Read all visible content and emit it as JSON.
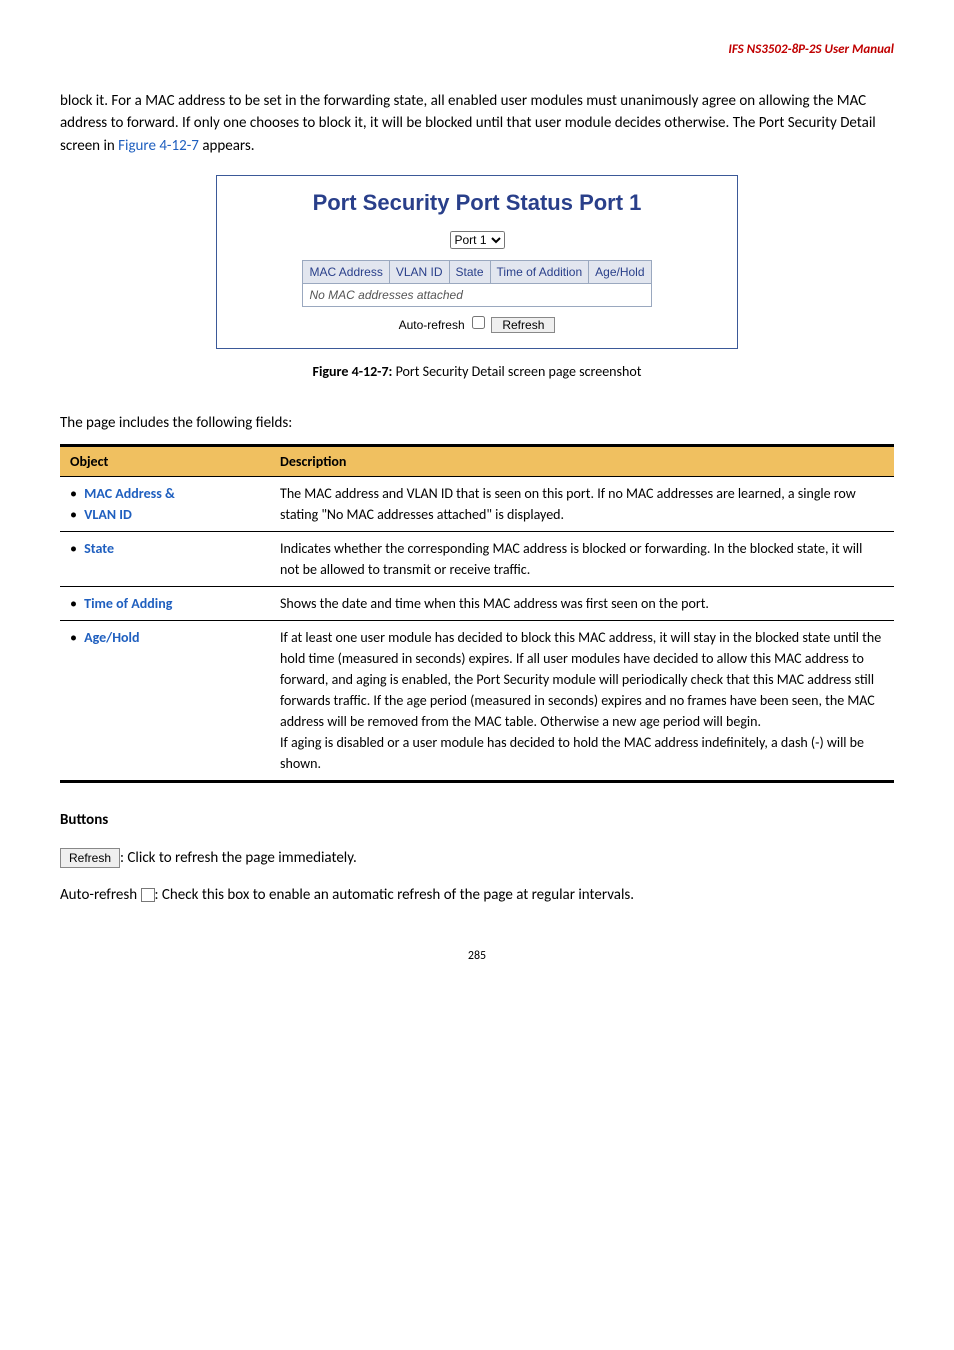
{
  "header": {
    "title": "IFS NS3502-8P-2S  User  Manual"
  },
  "intro": {
    "text_before_link": "block it. For a MAC address to be set in the forwarding state, all enabled user modules must unanimously agree on allowing the MAC address to forward. If only one chooses to block it, it will be blocked until that user module decides otherwise. The Port Security Detail screen in ",
    "link_text": "Figure 4-12-7",
    "text_after_link": " appears."
  },
  "figure": {
    "title": "Port Security Port Status  Port 1",
    "port_select_value": "Port 1",
    "columns": [
      "MAC Address",
      "VLAN ID",
      "State",
      "Time of Addition",
      "Age/Hold"
    ],
    "empty_row": "No MAC addresses attached",
    "auto_refresh_label": "Auto-refresh",
    "refresh_label": "Refresh"
  },
  "figure_caption": {
    "bold": "Figure 4-12-7:",
    "rest": " Port Security Detail screen page screenshot"
  },
  "table_lead": "The page includes the following fields:",
  "desc_table": {
    "head": {
      "object": "Object",
      "description": "Description"
    },
    "rows": [
      {
        "object_lines": [
          "MAC Address &",
          "VLAN ID"
        ],
        "description": "The MAC address and VLAN ID that is seen on this port. If no MAC addresses are learned, a single row stating \"No MAC addresses attached\" is displayed."
      },
      {
        "object_lines": [
          "State"
        ],
        "description": "Indicates whether the corresponding MAC address is blocked or forwarding. In the blocked state, it will not be allowed to transmit or receive traffic."
      },
      {
        "object_lines": [
          "Time of Adding"
        ],
        "description": "Shows the date and time when this MAC address was first seen on the port."
      },
      {
        "object_lines": [
          "Age/Hold"
        ],
        "description": "If at least one user module has decided to block this MAC address, it will stay in the blocked state until the hold time (measured in seconds) expires. If all user modules have decided to allow this MAC address to forward, and aging is enabled, the Port Security module will periodically check that this MAC address still forwards traffic. If the age period (measured in seconds) expires and no frames have been seen, the MAC address will be removed from the MAC table. Otherwise a new age period will begin.\nIf aging is disabled or a user module has decided to hold the MAC address indefinitely, a dash (-) will be shown."
      }
    ]
  },
  "buttons_section": {
    "heading": "Buttons",
    "refresh_btn": "Refresh",
    "refresh_text": ": Click to refresh the page immediately.",
    "autorefresh_prefix": "Auto-refresh ",
    "autorefresh_text": ": Check this box to enable an automatic refresh of the page at regular intervals."
  },
  "page_number": "285"
}
